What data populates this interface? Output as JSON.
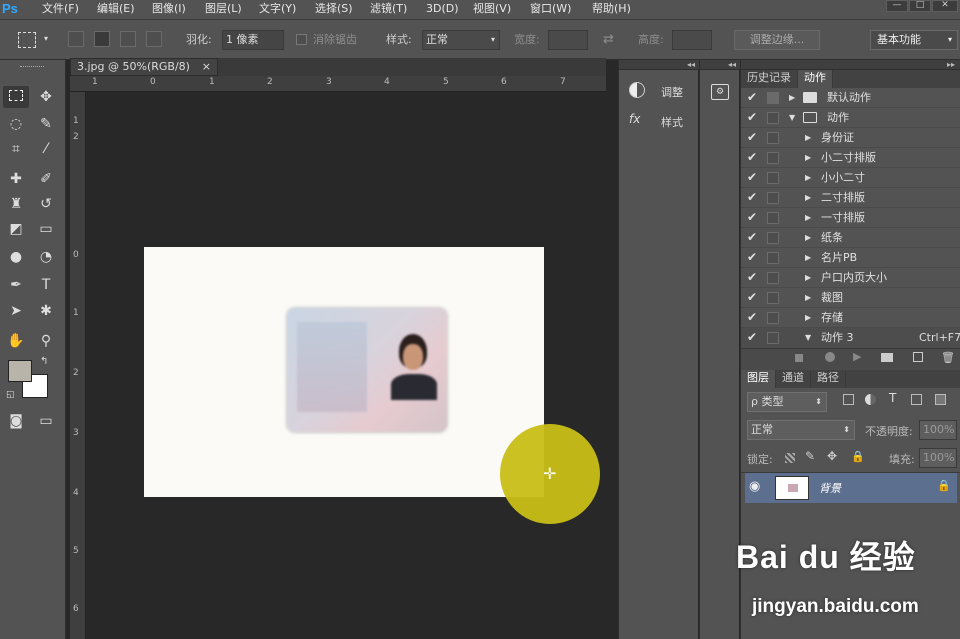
{
  "app": {
    "logo": "Ps"
  },
  "menu": [
    "文件(F)",
    "编辑(E)",
    "图像(I)",
    "图层(L)",
    "文字(Y)",
    "选择(S)",
    "滤镜(T)",
    "3D(D)",
    "视图(V)",
    "窗口(W)",
    "帮助(H)"
  ],
  "window_buttons": [
    "—",
    "□",
    "✕"
  ],
  "options": {
    "feather_label": "羽化:",
    "feather_value": "1 像素",
    "antialias_label": "消除锯齿",
    "style_label": "样式:",
    "style_value": "正常",
    "width_label": "宽度:",
    "height_label": "高度:",
    "refine_edge": "调整边缘...",
    "workspace": "基本功能"
  },
  "document": {
    "tab_title": "3.jpg @ 50%(RGB/8)",
    "close": "×",
    "ruler_h": [
      "1",
      "0",
      "1",
      "2",
      "3",
      "4",
      "5",
      "6",
      "7"
    ],
    "ruler_v": [
      "1",
      "2",
      "0",
      "1",
      "2",
      "3",
      "4",
      "5",
      "6"
    ]
  },
  "dock": {
    "adjust_label": "调整",
    "styles_label": "样式"
  },
  "history_panel": {
    "tabs": [
      "历史记录",
      "动作"
    ],
    "actions": [
      {
        "label": "默认动作",
        "type": "set",
        "expanded": false
      },
      {
        "label": "动作",
        "type": "set",
        "expanded": true
      },
      {
        "label": "身份证",
        "type": "action"
      },
      {
        "label": "小二寸排版",
        "type": "action"
      },
      {
        "label": "小小二寸",
        "type": "action"
      },
      {
        "label": "二寸排版",
        "type": "action"
      },
      {
        "label": "一寸排版",
        "type": "action"
      },
      {
        "label": "纸条",
        "type": "action"
      },
      {
        "label": "名片PB",
        "type": "action"
      },
      {
        "label": "户口内页大小",
        "type": "action"
      },
      {
        "label": "裁图",
        "type": "action"
      },
      {
        "label": "存储",
        "type": "action"
      },
      {
        "label": "动作 3",
        "type": "action",
        "expanded": true,
        "shortcut": "Ctrl+F7"
      }
    ],
    "check": "✔"
  },
  "layers_panel": {
    "tabs": [
      "图层",
      "通道",
      "路径"
    ],
    "filter_kind": "ρ 类型",
    "blend_mode": "正常",
    "opacity_label": "不透明度:",
    "opacity_value": "100%",
    "lock_label": "锁定:",
    "fill_label": "填充:",
    "fill_value": "100%",
    "layer_name": "背景"
  },
  "watermark": {
    "brand": "Bai du 经验",
    "url": "jingyan.baidu.com"
  }
}
